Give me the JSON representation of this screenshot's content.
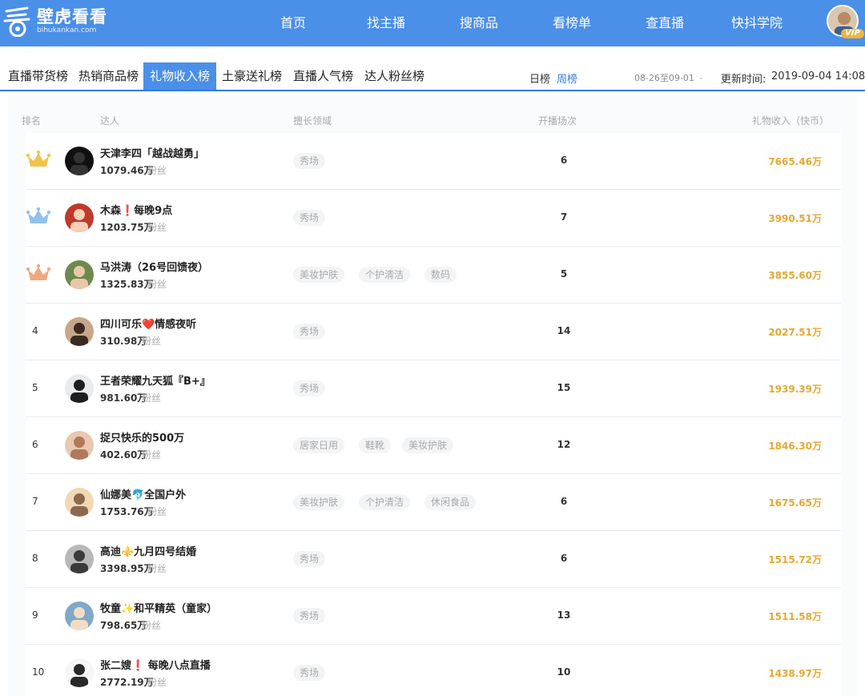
{
  "brand": {
    "name": "壁虎看看",
    "url": "bihukankan.com"
  },
  "nav": [
    "首页",
    "找主播",
    "搜商品",
    "看榜单",
    "查直播",
    "快抖学院"
  ],
  "user": {
    "badge": "VIP"
  },
  "tabs": [
    "直播带货榜",
    "热销商品榜",
    "礼物收入榜",
    "土豪送礼榜",
    "直播人气榜",
    "达人粉丝榜"
  ],
  "active_tab": "礼物收入榜",
  "period": {
    "daily": "日榜",
    "weekly": "周榜",
    "selected": "周榜"
  },
  "date_range": "08-26至09-01",
  "update": {
    "label": "更新时间:",
    "time": "2019-09-04 14:08"
  },
  "columns": {
    "rank": "排名",
    "talent": "达人",
    "domain": "擅长领域",
    "sessions": "开播场次",
    "income": "礼物收入（快币）"
  },
  "fans_label": "粉丝",
  "colors": {
    "accent": "#4a8fe8",
    "income": "#e5a832",
    "gold": "#f2c24a",
    "silver": "#8fc3ea",
    "bronze": "#f0a77d"
  },
  "rows": [
    {
      "rank": "1",
      "medal": "gold",
      "name": "天津李四「越战越勇」",
      "fans": "1079.46万",
      "tags": [
        "秀场"
      ],
      "sessions": "6",
      "income": "7665.46万"
    },
    {
      "rank": "2",
      "medal": "silver",
      "name": "木森❗每晚9点",
      "fans": "1203.75万",
      "tags": [
        "秀场"
      ],
      "sessions": "7",
      "income": "3990.51万"
    },
    {
      "rank": "3",
      "medal": "bronze",
      "name": "马洪涛（26号回馈夜）",
      "fans": "1325.83万",
      "tags": [
        "美妆护肤",
        "个护清洁",
        "数码"
      ],
      "sessions": "5",
      "income": "3855.60万"
    },
    {
      "rank": "4",
      "medal": "",
      "name": "四川可乐❤️情感夜听",
      "fans": "310.98万",
      "tags": [
        "秀场"
      ],
      "sessions": "14",
      "income": "2027.51万"
    },
    {
      "rank": "5",
      "medal": "",
      "name": "王者荣耀九天狐『B+』",
      "fans": "981.60万",
      "tags": [
        "秀场"
      ],
      "sessions": "15",
      "income": "1939.39万"
    },
    {
      "rank": "6",
      "medal": "",
      "name": "捉只快乐的500万",
      "fans": "402.60万",
      "tags": [
        "居家日用",
        "鞋靴",
        "美妆护肤"
      ],
      "sessions": "12",
      "income": "1846.30万"
    },
    {
      "rank": "7",
      "medal": "",
      "name": "仙娜美🐬全国户外",
      "fans": "1753.76万",
      "tags": [
        "美妆护肤",
        "个护清洁",
        "休闲食品"
      ],
      "sessions": "6",
      "income": "1675.65万"
    },
    {
      "rank": "8",
      "medal": "",
      "name": "高迪⚜️九月四号结婚",
      "fans": "3398.95万",
      "tags": [
        "秀场"
      ],
      "sessions": "6",
      "income": "1515.72万"
    },
    {
      "rank": "9",
      "medal": "",
      "name": "牧童✨和平精英（童家）",
      "fans": "798.65万",
      "tags": [
        "秀场"
      ],
      "sessions": "13",
      "income": "1511.58万"
    },
    {
      "rank": "10",
      "medal": "",
      "name": "张二嫂❗ 每晚八点直播",
      "fans": "2772.19万",
      "tags": [
        "秀场"
      ],
      "sessions": "10",
      "income": "1438.97万"
    }
  ]
}
